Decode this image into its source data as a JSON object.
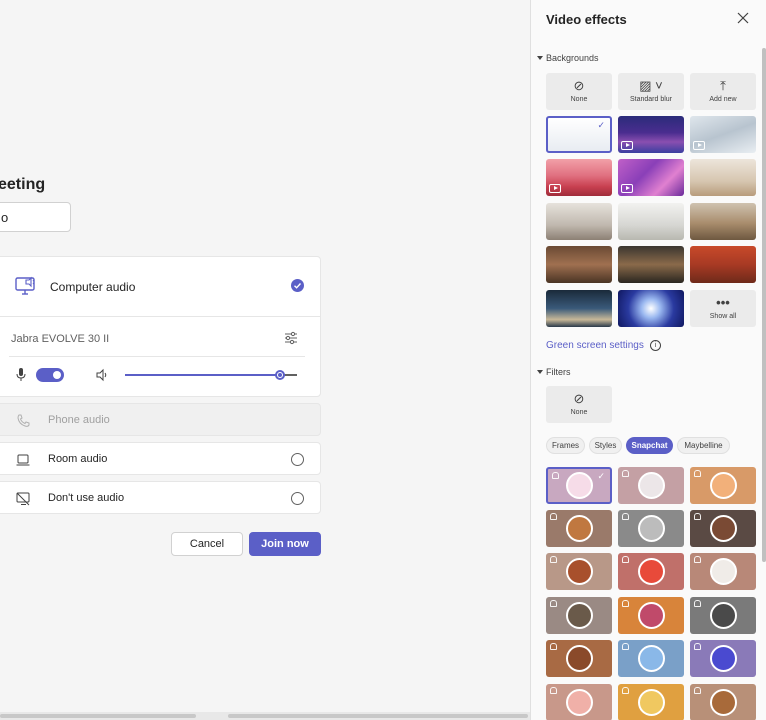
{
  "meeting": {
    "title": "eeting",
    "name_value": "o"
  },
  "audio": {
    "computer_label": "Computer audio",
    "device_label": "Jabra EVOLVE 30 II",
    "phone_label": "Phone audio",
    "room_label": "Room audio",
    "none_label": "Don't use audio",
    "volume_level": 0.9
  },
  "actions": {
    "cancel_label": "Cancel",
    "join_label": "Join now"
  },
  "panel": {
    "title": "Video effects",
    "backgrounds_label": "Backgrounds",
    "none_label": "None",
    "blur_label": "Standard blur",
    "add_label": "Add new",
    "show_all_label": "Show all",
    "green_screen_label": "Green screen settings",
    "filters_label": "Filters",
    "filter_none_label": "None",
    "filter_tabs": [
      "Frames",
      "Styles",
      "Snapchat",
      "Maybelline"
    ],
    "active_filter_tab": "Snapchat"
  },
  "colors": {
    "accent": "#5b5fc7"
  }
}
